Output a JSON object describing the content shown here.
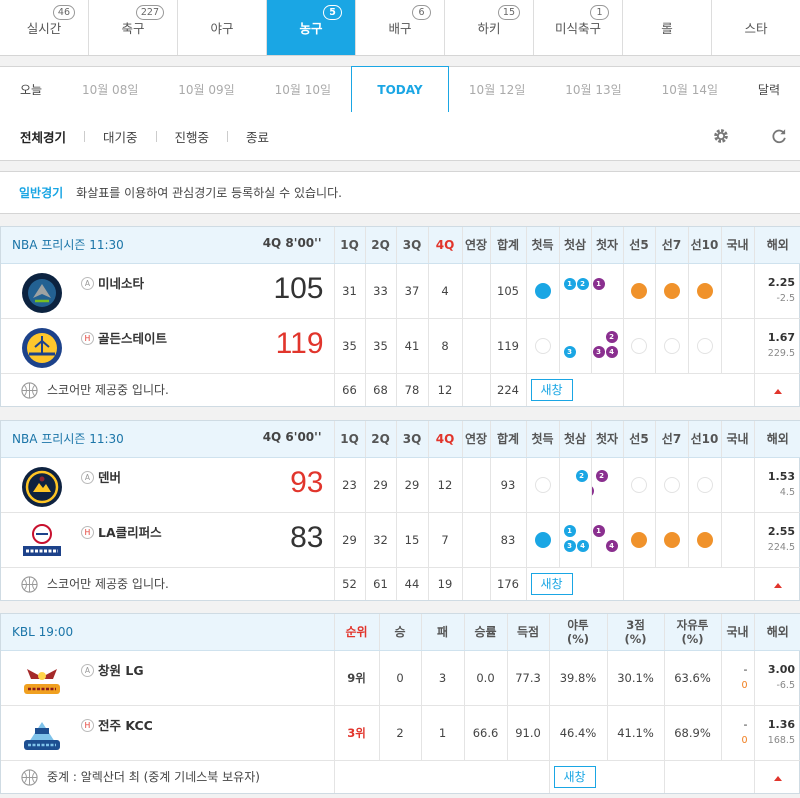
{
  "sports_tabs": [
    {
      "label": "실시간",
      "badge": "46"
    },
    {
      "label": "축구",
      "badge": "227"
    },
    {
      "label": "야구",
      "badge": ""
    },
    {
      "label": "농구",
      "badge": "5",
      "active": true
    },
    {
      "label": "배구",
      "badge": "6"
    },
    {
      "label": "하키",
      "badge": "15"
    },
    {
      "label": "미식축구",
      "badge": "1"
    },
    {
      "label": "롤",
      "badge": ""
    },
    {
      "label": "스타",
      "badge": ""
    }
  ],
  "dates": {
    "today_btn": "오늘",
    "d1": "10월 08일",
    "d2": "10월 09일",
    "d3": "10월 10일",
    "today": "TODAY",
    "d5": "10월 12일",
    "d6": "10월 13일",
    "d7": "10월 14일",
    "calendar": "달력"
  },
  "filters": {
    "all": "전체경기",
    "waiting": "대기중",
    "live": "진행중",
    "ended": "종료"
  },
  "notice": {
    "label": "일반경기",
    "text": "화살표를 이용하여 관심경기로 등록하실 수 있습니다."
  },
  "nba_headers": {
    "q1": "1Q",
    "q2": "2Q",
    "q3": "3Q",
    "q4": "4Q",
    "ot": "연장",
    "total": "합계",
    "first_score": "첫득",
    "first_3": "첫삼",
    "first_ft": "첫자",
    "to5": "선5",
    "to7": "선7",
    "to10": "선10",
    "domestic": "국내",
    "overseas": "해외"
  },
  "game1": {
    "league": "NBA 프리시즌  11:30",
    "status": "4Q 8'00''",
    "home_mark": "H",
    "away_mark": "A",
    "away": {
      "name": "미네소타",
      "score": "105",
      "q": [
        "31",
        "33",
        "37",
        "4"
      ],
      "ot": "",
      "total": "105",
      "odds": "2.25",
      "line": "-2.5"
    },
    "home": {
      "name": "골든스테이트",
      "score": "119",
      "q": [
        "35",
        "35",
        "41",
        "8"
      ],
      "ot": "",
      "total": "119",
      "odds": "1.67",
      "line": "229.5"
    },
    "sum": {
      "q": [
        "66",
        "68",
        "78",
        "12"
      ],
      "total": "224"
    },
    "away_events": {
      "f3": [
        "1",
        "2"
      ],
      "fft": [
        "1"
      ]
    },
    "home_events": {
      "f3": [
        "3"
      ],
      "fft": [
        "2",
        "3",
        "4"
      ]
    },
    "footer": "스코어만 제공중 입니다.",
    "chat": "새창"
  },
  "game2": {
    "league": "NBA 프리시즌  11:30",
    "status": "4Q 6'00''",
    "home_mark": "H",
    "away_mark": "A",
    "away": {
      "name": "덴버",
      "score": "93",
      "q": [
        "23",
        "29",
        "29",
        "12"
      ],
      "ot": "",
      "total": "93",
      "odds": "1.53",
      "line": "4.5"
    },
    "home": {
      "name": "LA클리퍼스",
      "score": "83",
      "q": [
        "29",
        "32",
        "15",
        "7"
      ],
      "ot": "",
      "total": "83",
      "odds": "2.55",
      "line": "224.5"
    },
    "sum": {
      "q": [
        "52",
        "61",
        "44",
        "19"
      ],
      "total": "176"
    },
    "away_events": {
      "f3": [
        "2"
      ],
      "fft": [
        "2",
        "3"
      ]
    },
    "home_events": {
      "f3": [
        "1",
        "3",
        "4"
      ],
      "fft": [
        "1",
        "4"
      ]
    },
    "footer": "스코어만 제공중 입니다.",
    "chat": "새창"
  },
  "game3": {
    "league": "KBL  19:00",
    "headers": {
      "rank": "순위",
      "w": "승",
      "l": "패",
      "pct": "승률",
      "pts": "득점",
      "fg": "야투",
      "fg_unit": "(%)",
      "tp": "3점",
      "tp_unit": "(%)",
      "ft": "자유투",
      "ft_unit": "(%)",
      "domestic": "국내",
      "overseas": "해외"
    },
    "away_mark": "A",
    "home_mark": "H",
    "away": {
      "name": "창원 LG",
      "rank": "9위",
      "w": "0",
      "l": "3",
      "pct": "0.0",
      "pts": "77.3",
      "fg": "39.8%",
      "tp": "30.1%",
      "ft": "63.6%",
      "dom1": "-",
      "dom2": "0",
      "odds": "3.00",
      "line": "-6.5"
    },
    "home": {
      "name": "전주 KCC",
      "rank": "3위",
      "w": "2",
      "l": "1",
      "pct": "66.6",
      "pts": "91.0",
      "fg": "46.4%",
      "tp": "41.1%",
      "ft": "68.9%",
      "dom1": "-",
      "dom2": "0",
      "odds": "1.36",
      "line": "168.5"
    },
    "footer": "중계 : 알렉산더 최 (중계 기네스북 보유자)",
    "chat": "새창"
  },
  "colors": {
    "accent": "#1aa6e4",
    "red": "#e1352c",
    "purple": "#8a2f8f",
    "orange": "#f0922b"
  }
}
